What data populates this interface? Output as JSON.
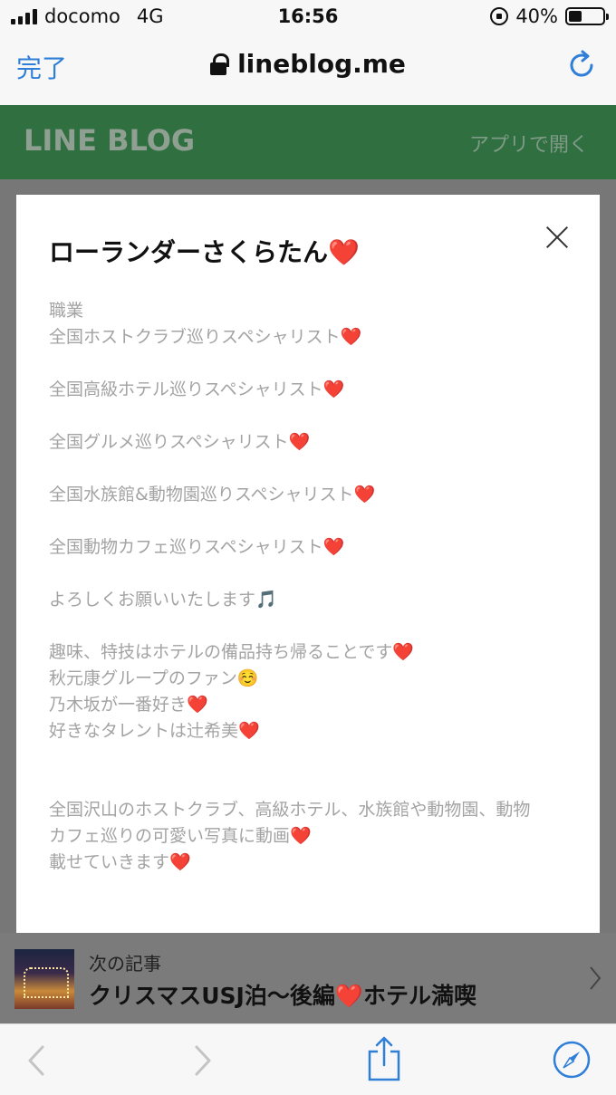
{
  "status_bar": {
    "carrier": "docomo",
    "network": "4G",
    "time": "16:56",
    "battery": "40%",
    "battery_level": 0.4
  },
  "browser": {
    "done_label": "完了",
    "url": "lineblog.me"
  },
  "site": {
    "logo": "LINE BLOG",
    "open_app": "アプリで開く",
    "brand_color": "#2f6f40"
  },
  "profile_modal": {
    "title": "ローランダーさくらたん❤️",
    "bio_lines": [
      "職業",
      "全国ホストクラブ巡りスペシャリスト❤️",
      "",
      "全国高級ホテル巡りスペシャリスト❤️",
      "",
      "全国グルメ巡りスペシャリスト❤️",
      "",
      "全国水族館&動物園巡りスペシャリスト❤️",
      "",
      "全国動物カフェ巡りスペシャリスト❤️",
      "",
      "よろしくお願いいたします🎵",
      "",
      "趣味、特技はホテルの備品持ち帰ることです❤️",
      "秋元康グループのファン☺️",
      "乃木坂が一番好き❤️",
      "好きなタレントは辻希美❤️",
      "",
      "",
      "全国沢山のホストクラブ、高級ホテル、水族館や動物園、動物",
      "カフェ巡りの可愛い写真に動画❤️",
      "載せていきます❤️"
    ]
  },
  "next_article": {
    "label": "次の記事",
    "title": "クリスマスUSJ泊〜後編❤️ホテル満喫"
  },
  "toolbar": {
    "icons": [
      "back-icon",
      "forward-icon",
      "share-icon",
      "compass-icon"
    ]
  }
}
